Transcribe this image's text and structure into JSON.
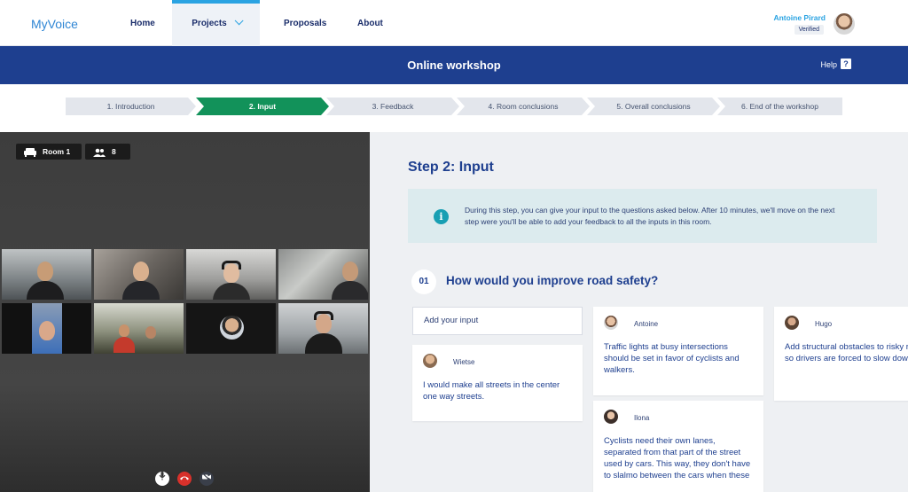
{
  "app": {
    "logo": "MyVoice"
  },
  "nav": {
    "home": "Home",
    "projects": "Projects",
    "proposals": "Proposals",
    "about": "About"
  },
  "user": {
    "name": "Antoine Pirard",
    "badge": "Verified"
  },
  "banner": {
    "title": "Online workshop",
    "help": "Help",
    "help_icon": "?"
  },
  "steps": [
    {
      "label": "1. Introduction",
      "active": false
    },
    {
      "label": "2. Input",
      "active": true
    },
    {
      "label": "3. Feedback",
      "active": false
    },
    {
      "label": "4. Room conclusions",
      "active": false
    },
    {
      "label": "5. Overall conclusions",
      "active": false
    },
    {
      "label": "6. End of the workshop",
      "active": false
    }
  ],
  "video": {
    "room_label": "Room 1",
    "participant_count": "8",
    "icons": [
      "sofa-icon",
      "people-icon",
      "microphone-icon",
      "hang-up-icon",
      "camera-off-icon"
    ]
  },
  "content": {
    "step_title": "Step 2: Input",
    "info_text": "During this step, you can give your input to the questions asked below. After 10 minutes, we'll move on the next step were you'll be able to add your feedback to all the inputs in this room.",
    "question_number": "01",
    "question": "How would you improve road safety?",
    "add_input_placeholder": "Add your input",
    "cards": {
      "wietse": {
        "name": "Wietse",
        "text": "I would make all streets in the center one way streets."
      },
      "antoine": {
        "name": "Antoine",
        "text": "Traffic lights at busy intersections should be set in favor of cyclists and walkers."
      },
      "ilona": {
        "name": "Ilona",
        "text": "Cyclists need their own lanes, separated from that part of the street used by cars. This way, they don't have to slalmo between the cars when these"
      },
      "hugo": {
        "name": "Hugo",
        "text": "Add structural obstacles to risky roads so drivers are forced to slow down."
      }
    }
  },
  "colors": {
    "brand_blue": "#1e3f8f",
    "accent_cyan": "#2aa3e2",
    "active_step_green": "#12925a",
    "hangup_red": "#d8312b"
  }
}
